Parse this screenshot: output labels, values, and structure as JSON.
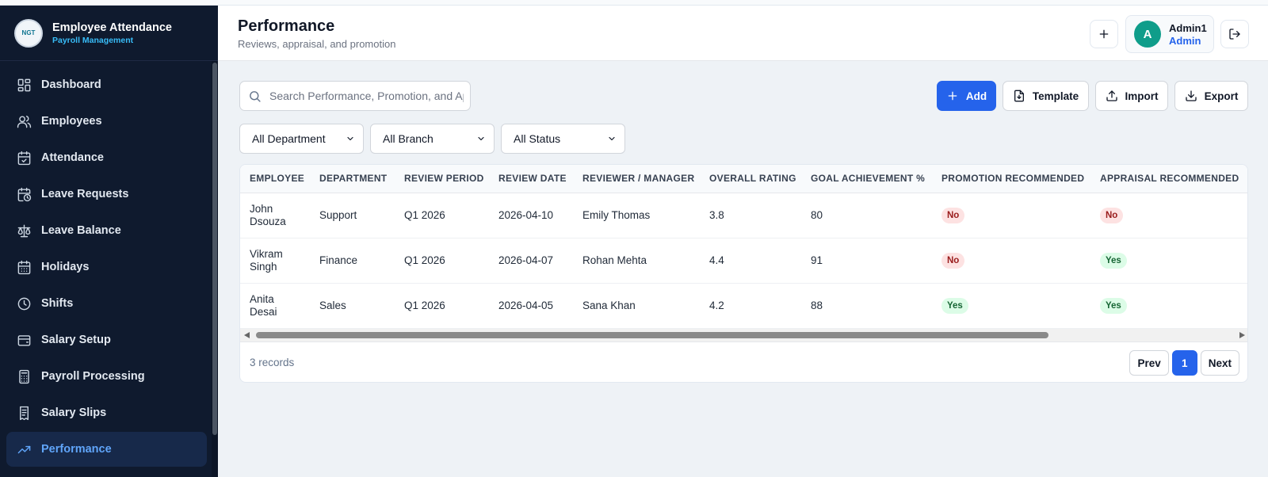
{
  "brand": {
    "logo_text": "NGT",
    "title": "Employee Attendance",
    "subtitle": "Payroll Management"
  },
  "sidebar": {
    "items": [
      {
        "label": "Dashboard",
        "icon": "dashboard-icon"
      },
      {
        "label": "Employees",
        "icon": "users-icon"
      },
      {
        "label": "Attendance",
        "icon": "calendar-check-icon"
      },
      {
        "label": "Leave Requests",
        "icon": "calendar-clock-icon"
      },
      {
        "label": "Leave Balance",
        "icon": "scale-icon"
      },
      {
        "label": "Holidays",
        "icon": "calendar-icon"
      },
      {
        "label": "Shifts",
        "icon": "clock-icon"
      },
      {
        "label": "Salary Setup",
        "icon": "wallet-icon"
      },
      {
        "label": "Payroll Processing",
        "icon": "calculator-icon"
      },
      {
        "label": "Salary Slips",
        "icon": "receipt-icon"
      },
      {
        "label": "Performance",
        "icon": "trending-up-icon",
        "active": true
      }
    ]
  },
  "header": {
    "title": "Performance",
    "subtitle": "Reviews, appraisal, and promotion",
    "user": {
      "initial": "A",
      "name": "Admin1",
      "role": "Admin"
    }
  },
  "toolbar": {
    "search_placeholder": "Search Performance, Promotion, and Appraisal",
    "add_label": "Add",
    "template_label": "Template",
    "import_label": "Import",
    "export_label": "Export"
  },
  "filters": {
    "department": "All Department",
    "branch": "All Branch",
    "status": "All Status"
  },
  "table": {
    "columns": [
      "EMPLOYEE",
      "DEPARTMENT",
      "REVIEW PERIOD",
      "REVIEW DATE",
      "REVIEWER / MANAGER",
      "OVERALL RATING",
      "GOAL ACHIEVEMENT %",
      "PROMOTION RECOMMENDED",
      "APPRAISAL RECOMMENDED"
    ],
    "rows": [
      {
        "employee": "John Dsouza",
        "department": "Support",
        "period": "Q1 2026",
        "date": "2026-04-10",
        "reviewer": "Emily Thomas",
        "rating": "3.8",
        "goal": "80",
        "promotion": "No",
        "appraisal": "No"
      },
      {
        "employee": "Vikram Singh",
        "department": "Finance",
        "period": "Q1 2026",
        "date": "2026-04-07",
        "reviewer": "Rohan Mehta",
        "rating": "4.4",
        "goal": "91",
        "promotion": "No",
        "appraisal": "Yes"
      },
      {
        "employee": "Anita Desai",
        "department": "Sales",
        "period": "Q1 2026",
        "date": "2026-04-05",
        "reviewer": "Sana Khan",
        "rating": "4.2",
        "goal": "88",
        "promotion": "Yes",
        "appraisal": "Yes"
      }
    ]
  },
  "footer": {
    "records": "3 records",
    "prev": "Prev",
    "page": "1",
    "next": "Next"
  },
  "colors": {
    "primary": "#2563eb",
    "sidebar_bg": "#0f1a2e",
    "active_nav": "#60a5fa",
    "avatar": "#0f9d8a"
  }
}
